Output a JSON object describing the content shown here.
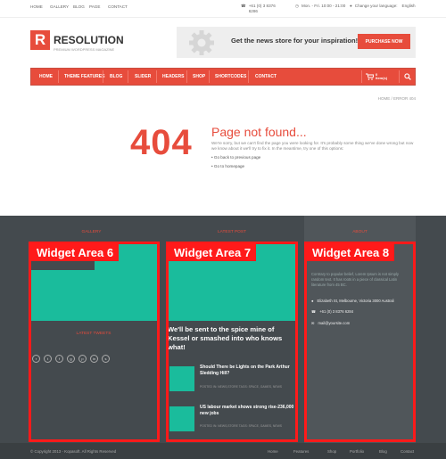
{
  "topbar": {
    "nav": [
      "HOME",
      "GALLERY",
      "BLOG",
      "PAGE",
      "CONTACT"
    ],
    "phone": "+61 (0) 3 8376 6286",
    "hours": "Mon. - Fri. 10:00 - 21:00",
    "language_label": "Change your language:",
    "language": "English"
  },
  "brand": {
    "mark": "R",
    "name": "RESOLUTION",
    "tagline": "PREMIUM WORDPRESS MAGAZINE"
  },
  "banner": {
    "text": "Get the news store for your inspiration!",
    "button": "PURCHASE NOW"
  },
  "nav": {
    "items": [
      "HOME",
      "THEME FEATURES",
      "BLOG",
      "SLIDER",
      "HEADERS",
      "SHOP",
      "SHORTCODES",
      "CONTACT"
    ],
    "cart_count": "0",
    "cart_label": "item(s)"
  },
  "breadcrumb": "HOME / ERROR 404",
  "error": {
    "code": "404",
    "title": "Page not found...",
    "text": "We're sorry, but we can't find the page you were looking for. It's probably some thing we've done wrong but now we know about it we'll try to fix it. In the meantime, try one of this options:",
    "links": [
      "Go back to previous page",
      "Go to homepage"
    ]
  },
  "footer": {
    "gallery_title": "GALLERY",
    "latest_title": "LATEST POST",
    "about_title": "ABOUT",
    "widget6": "Widget Area 6",
    "widget7": "Widget Area 7",
    "widget8": "Widget Area 8",
    "tweets_title": "LATEST TWEETS",
    "latest_headline": "We'll be sent to the spice mine of Kessel or smashed into who knows what!",
    "posts": [
      {
        "title": "Should There be Lights on the Park Arthur Sledding Hill?",
        "meta": "POSTED IN: NEWS,STORE    TAGS: SPACE, GAMES, NEWS"
      },
      {
        "title": "US labour market shows strong rise-236,000 new jobs",
        "meta": "POSTED IN: NEWS,STORE    TAGS: SPACE, GAMES, NEWS"
      }
    ],
    "about_text": "Contrary to popular belief, Lorem Ipsum is not simply random text. It has roots in a piece of classical Latin literature from 45 BC.",
    "address": "Elizabeth St, Melbourne, Victoria 3000 Australi",
    "phone": "+61 (0) 3 8376 6284",
    "email": "mail@yoursite.com"
  },
  "bottombar": {
    "copyright": "© Copyright 2013 - Kopasoft. All Rights Reserved",
    "links": [
      "Home",
      "Features",
      "Shop",
      "Portfolio",
      "Blog",
      "Contact"
    ]
  },
  "colors": {
    "accent": "#e74c3c",
    "teal": "#1abc9c",
    "footer": "#444a4e",
    "highlight": "#ff1a1a"
  }
}
